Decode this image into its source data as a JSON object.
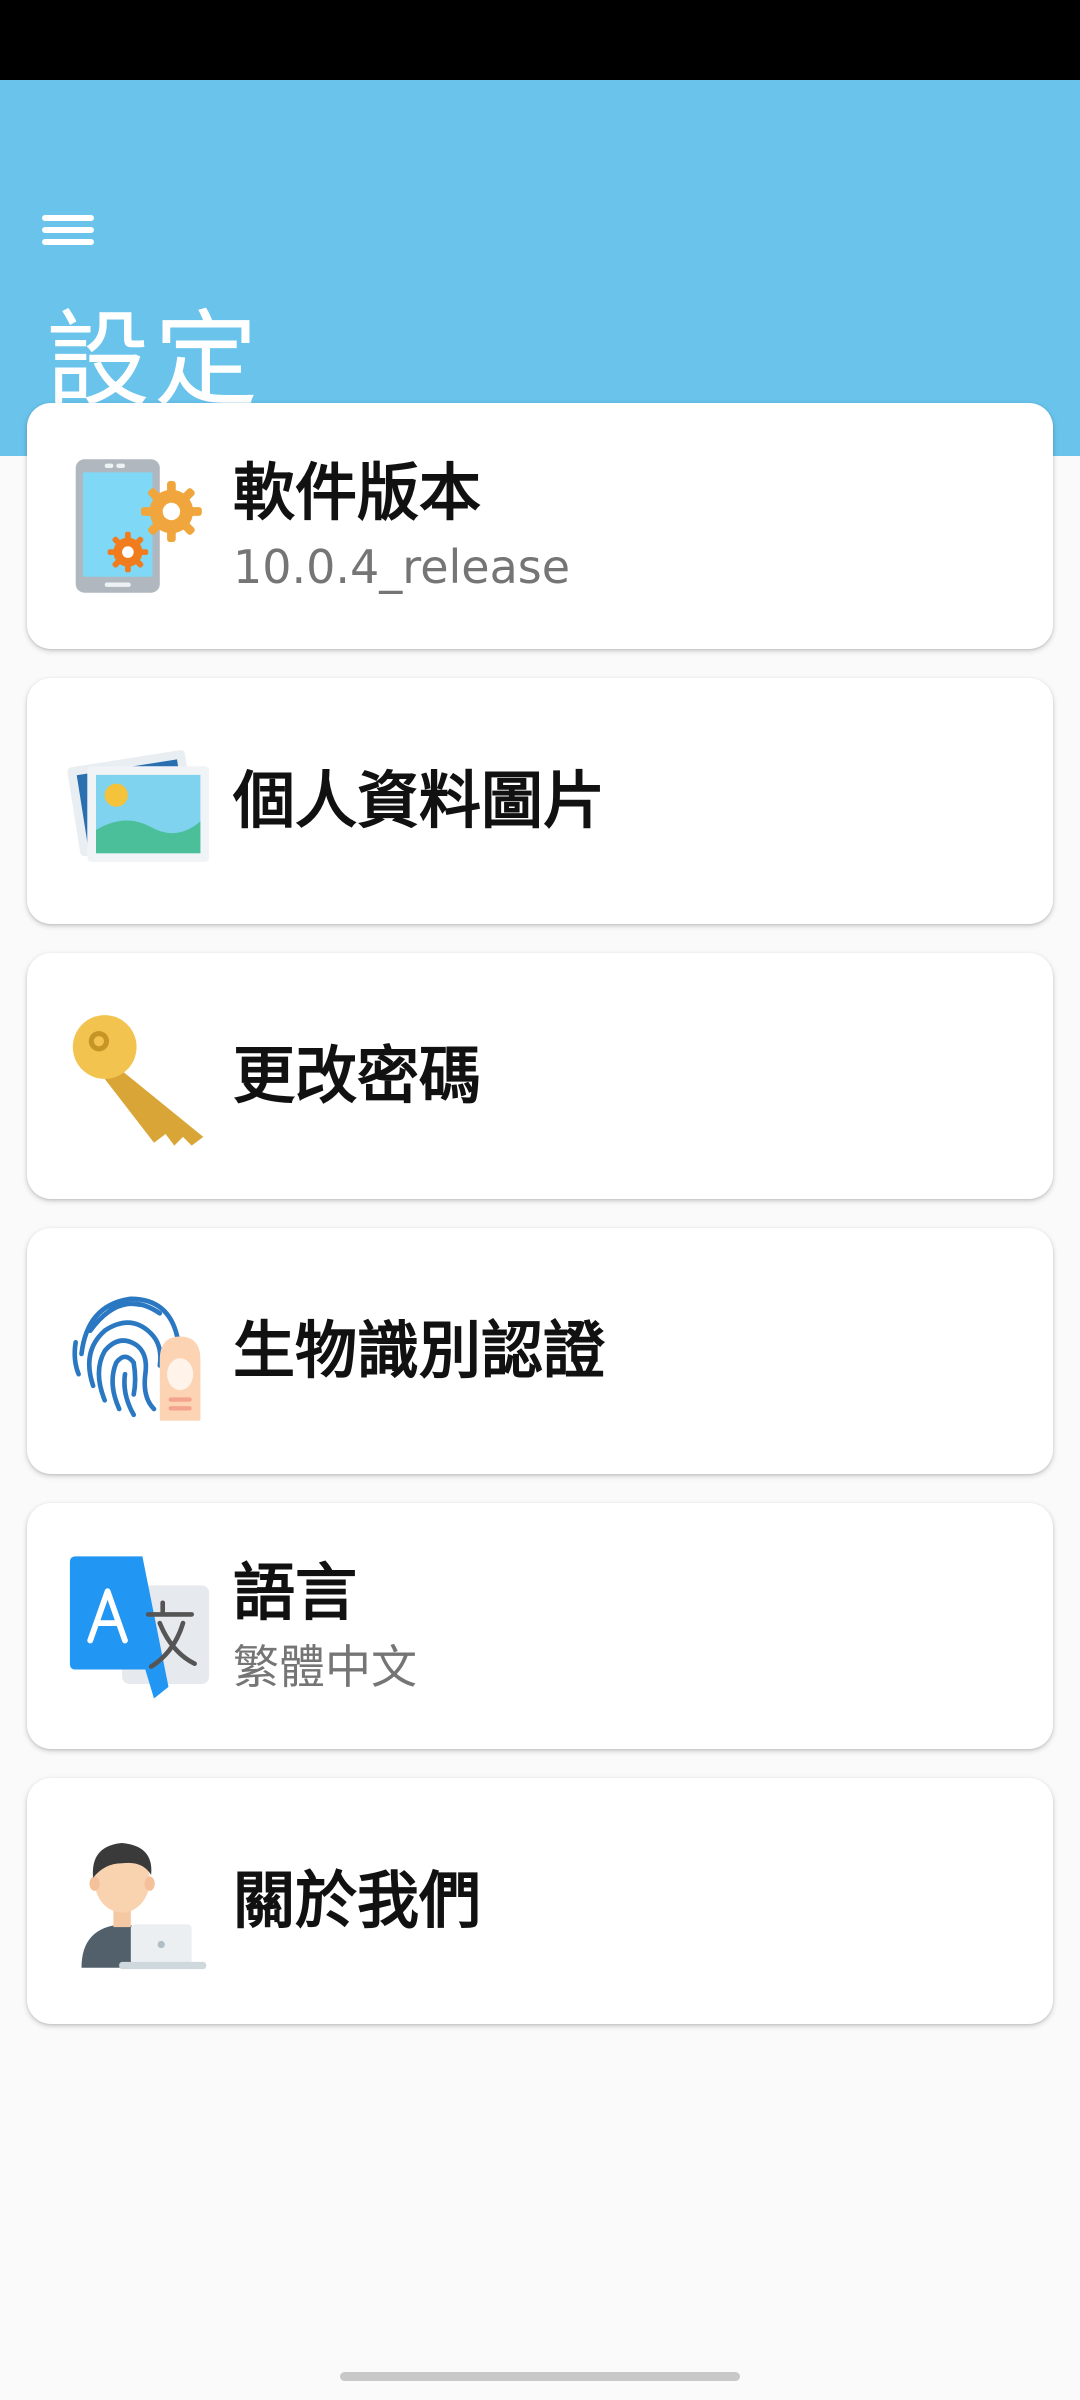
{
  "header": {
    "title": "設定",
    "menu_icon": "hamburger-menu-icon",
    "background_color": "#69c3eb"
  },
  "settings_items": [
    {
      "title": "軟件版本",
      "subtitle": "10.0.4_release",
      "icon": "phone-settings-icon"
    },
    {
      "title": "個人資料圖片",
      "icon": "picture-icon"
    },
    {
      "title": "更改密碼",
      "icon": "key-icon"
    },
    {
      "title": "生物識別認證",
      "icon": "fingerprint-icon"
    },
    {
      "title": "語言",
      "subtitle": "繁體中文",
      "icon": "translate-icon"
    },
    {
      "title": "關於我們",
      "icon": "user-laptop-icon"
    }
  ]
}
